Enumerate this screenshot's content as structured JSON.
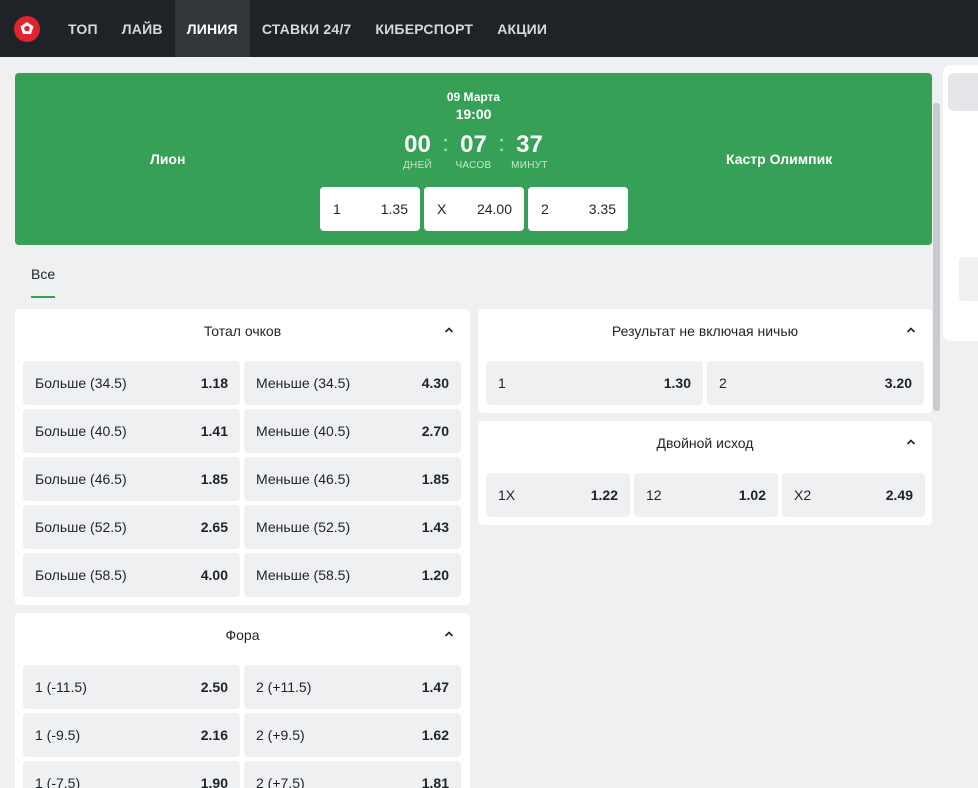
{
  "nav": {
    "items": [
      "ТОП",
      "ЛАЙВ",
      "ЛИНИЯ",
      "СТАВКИ 24/7",
      "КИБЕРСПОРТ",
      "АКЦИИ"
    ],
    "active": "ЛИНИЯ"
  },
  "colors": {
    "accent": "#37a057",
    "topbar": "#1f2226",
    "logo": "#e0242f"
  },
  "event": {
    "date": "09 Марта",
    "time": "19:00",
    "home": "Лион",
    "away": "Кастр Олимпик",
    "countdown": {
      "days": "00",
      "hours": "07",
      "minutes": "37",
      "days_label": "ДНЕЙ",
      "hours_label": "ЧАСОВ",
      "minutes_label": "МИНУТ",
      "separator": ":"
    },
    "odds": [
      {
        "label": "1",
        "value": "1.35"
      },
      {
        "label": "X",
        "value": "24.00"
      },
      {
        "label": "2",
        "value": "3.35"
      }
    ]
  },
  "tabs": {
    "all": "Все"
  },
  "markets": {
    "total": {
      "title": "Тотал очков",
      "rows": [
        [
          {
            "label": "Больше (34.5)",
            "value": "1.18"
          },
          {
            "label": "Меньше (34.5)",
            "value": "4.30"
          }
        ],
        [
          {
            "label": "Больше (40.5)",
            "value": "1.41"
          },
          {
            "label": "Меньше (40.5)",
            "value": "2.70"
          }
        ],
        [
          {
            "label": "Больше (46.5)",
            "value": "1.85"
          },
          {
            "label": "Меньше (46.5)",
            "value": "1.85"
          }
        ],
        [
          {
            "label": "Больше (52.5)",
            "value": "2.65"
          },
          {
            "label": "Меньше (52.5)",
            "value": "1.43"
          }
        ],
        [
          {
            "label": "Больше (58.5)",
            "value": "4.00"
          },
          {
            "label": "Меньше (58.5)",
            "value": "1.20"
          }
        ]
      ]
    },
    "handicap": {
      "title": "Фора",
      "rows": [
        [
          {
            "label": "1 (-11.5)",
            "value": "2.50"
          },
          {
            "label": "2 (+11.5)",
            "value": "1.47"
          }
        ],
        [
          {
            "label": "1 (-9.5)",
            "value": "2.16"
          },
          {
            "label": "2 (+9.5)",
            "value": "1.62"
          }
        ],
        [
          {
            "label": "1 (-7.5)",
            "value": "1.90"
          },
          {
            "label": "2 (+7.5)",
            "value": "1.81"
          }
        ]
      ]
    },
    "no_draw": {
      "title": "Результат не включая ничью",
      "cells": [
        {
          "label": "1",
          "value": "1.30"
        },
        {
          "label": "2",
          "value": "3.20"
        }
      ]
    },
    "double": {
      "title": "Двойной исход",
      "cells": [
        {
          "label": "1X",
          "value": "1.22"
        },
        {
          "label": "12",
          "value": "1.02"
        },
        {
          "label": "X2",
          "value": "2.49"
        }
      ]
    }
  }
}
